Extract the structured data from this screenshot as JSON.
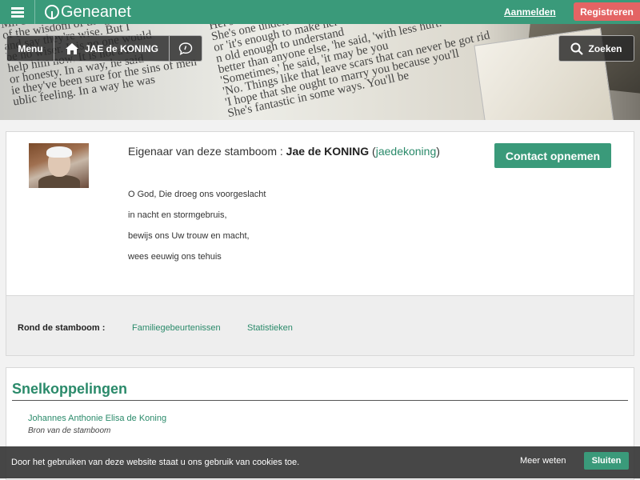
{
  "header": {
    "menu_icon": "hamburger-icon",
    "logo_text": "Geneanet",
    "logo_icon": "tree-icon",
    "login_label": "Aanmelden",
    "register_label": "Registreren"
  },
  "toolbar": {
    "menu_label": "Menu",
    "tree_label": "JAE de KONING",
    "tree_icon": "home-icon",
    "chat_icon": "chat-icon",
    "search_label": "Zoeken",
    "search_icon": "search-icon"
  },
  "banner": {
    "text_left": [
      "Mr. Stillman's have been put",
      "of the wisdom of the generation",
      "and say they're wise. But I",
      "be no wiser. It is no one would",
      "help him now. It is not a man",
      "or honesty. In a way, he said",
      "ie they've been sure for the sins of men",
      "ublic feeling. In a way he was"
    ],
    "text_right": [
      "Her's are tenants where do",
      "She's one understand a lot",
      "or 'it's enough to make her",
      "n old enough to understand",
      "better than anyone else, 'he said, 'with less hurt.",
      "'Sometimes,' he said, 'it may be you",
      "'No. Things like that leave scars that can never be got rid",
      "'I hope that she ought to marry you because you'll",
      "She's fantastic in some ways. You'll be"
    ]
  },
  "owner": {
    "prefix": "Eigenaar van deze stamboom : ",
    "name": "Jae de KONING",
    "open_paren": " (",
    "username": "jaedekoning",
    "close_paren": ")",
    "contact_label": "Contact opnemen",
    "poem": [
      "O God, Die droeg ons voorgeslacht",
      "in nacht en stormgebruis,",
      "bewijs ons Uw trouw en macht,",
      "wees eeuwig ons tehuis"
    ]
  },
  "rond": {
    "label": "Rond de stamboom :",
    "links": [
      "Familiegebeurtenissen",
      "Statistieken"
    ]
  },
  "quick": {
    "title": "Snelkoppelingen",
    "link": "Johannes Anthonie Elisa de Koning",
    "sub": "Bron van de stamboom"
  },
  "cookie": {
    "text": "Door het gebruiken van deze website staat u ons gebruik van cookies toe.",
    "more_label": "Meer weten",
    "close_label": "Sluiten"
  },
  "colors": {
    "brand": "#3a9a7a",
    "register": "#e46464",
    "link": "#2a8a6a"
  }
}
